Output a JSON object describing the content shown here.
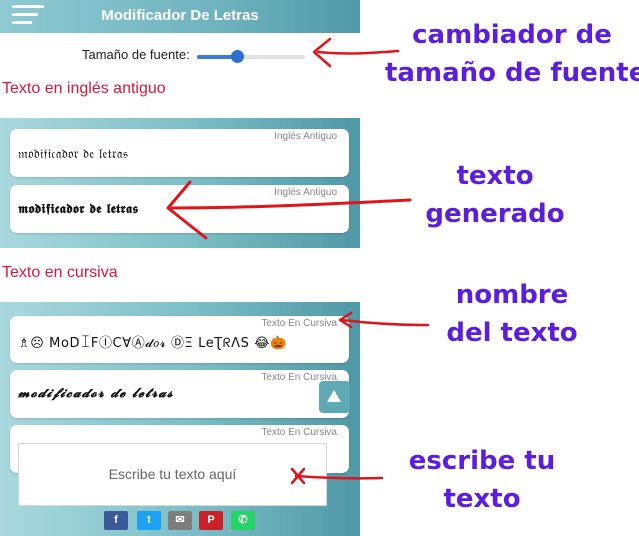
{
  "header": {
    "title": "Modificador De Letras"
  },
  "font_size": {
    "label": "Tamaño de fuente:",
    "value_fraction": 0.37
  },
  "sections": [
    {
      "title": "Texto en inglés antiguo",
      "cards": [
        {
          "label": "Inglés Antiguo",
          "text": "𝔪𝔬𝔡𝔦𝔣𝔦𝔠𝔞𝔡𝔬𝔯 𝔡𝔢 𝔩𝔢𝔱𝔯𝔞𝔰"
        },
        {
          "label": "Inglés Antiguo",
          "text": "𝖒𝖔𝖉𝖎𝖋𝖎𝖈𝖆𝖉𝖔𝖗 𝖉𝖊 𝖑𝖊𝖙𝖗𝖆𝖘"
        }
      ]
    },
    {
      "title": "Texto en cursiva",
      "cards": [
        {
          "label": "Texto En Cursiva",
          "text": "♗☹ MoDꀤFⒾCⱯⒶ𝓭𝑜𝓻 ⒹΞ LeƮᖇΛS 😂🎃"
        },
        {
          "label": "Texto En Cursiva",
          "text": "𝓶𝓸𝓭𝓲𝓯𝓲𝓬𝓪𝓭𝓸𝓻 𝓭𝓮 𝓵𝓮𝓽𝓻𝓪𝓼"
        },
        {
          "label": "Texto En Cursiva",
          "text": ""
        }
      ]
    }
  ],
  "input": {
    "placeholder": "Escribe tu texto aquí"
  },
  "share": [
    {
      "icon": "facebook-icon",
      "glyph": "f",
      "color": "#3b5998"
    },
    {
      "icon": "twitter-icon",
      "glyph": "t",
      "color": "#1da1f2"
    },
    {
      "icon": "email-icon",
      "glyph": "✉",
      "color": "#7d7d7d"
    },
    {
      "icon": "pinterest-icon",
      "glyph": "P",
      "color": "#cb2027"
    },
    {
      "icon": "whatsapp-icon",
      "glyph": "✆",
      "color": "#25d366"
    }
  ],
  "annotations": {
    "font_changer": "cambiador de\ntamaño de fuente",
    "generated_text": "texto\ngenerado",
    "text_name": "nombre\ndel texto",
    "write_text": "escribe tu\ntexto"
  },
  "colors": {
    "header": "#6fb3bf",
    "section_title": "#d6193c",
    "annotation": "#5b1ee0",
    "arrow": "#e0141c"
  }
}
